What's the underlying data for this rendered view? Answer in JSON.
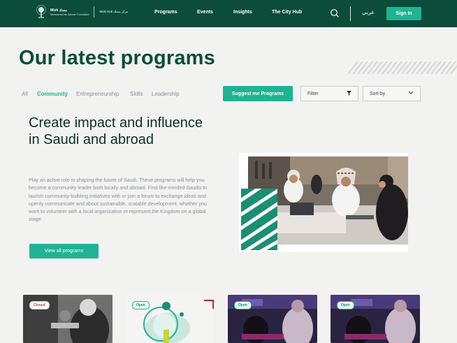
{
  "header": {
    "logo": {
      "line1": "Misk مسك",
      "line2": "Mohammed bin Salman Foundation",
      "hub": "Misk Hub مركز مسك"
    },
    "nav": [
      {
        "label": "Programs"
      },
      {
        "label": "Events"
      },
      {
        "label": "Insights"
      },
      {
        "label": "The City Hub"
      }
    ],
    "search_icon": "search-icon",
    "language": "عربي",
    "signin_label": "Sign In"
  },
  "hero": {
    "title": "Our latest programs"
  },
  "filters": {
    "tabs": [
      {
        "label": "All",
        "active": false
      },
      {
        "label": "Community",
        "active": true
      },
      {
        "label": "Entrepreneurship",
        "active": false
      },
      {
        "label": "Skills",
        "active": false
      },
      {
        "label": "Leadership",
        "active": false
      }
    ],
    "suggest_label": "Suggest me Programs",
    "filter_label": "Filter",
    "sort_label": "Sort by"
  },
  "intro": {
    "title": "Create impact and influence in Saudi and abroad",
    "body": "Play an active role in shaping the future of Saudi. These programs will help you become a community leader both locally and abroad. Find like-minded Saudis to launch community-building initiatives with or join a forum to exchange ideas and openly communicate and about sustainable, scalable development, whether you want to volunteer with a local organization or represent the Kingdom on a global stage.",
    "button_label": "View all programs"
  },
  "cards": [
    {
      "status": "Closed"
    },
    {
      "status": "Open"
    },
    {
      "status": "Open"
    },
    {
      "status": "Open"
    }
  ],
  "colors": {
    "brand_dark": "#0b4d3a",
    "accent": "#1fb394",
    "closed": "#d23a3a"
  }
}
